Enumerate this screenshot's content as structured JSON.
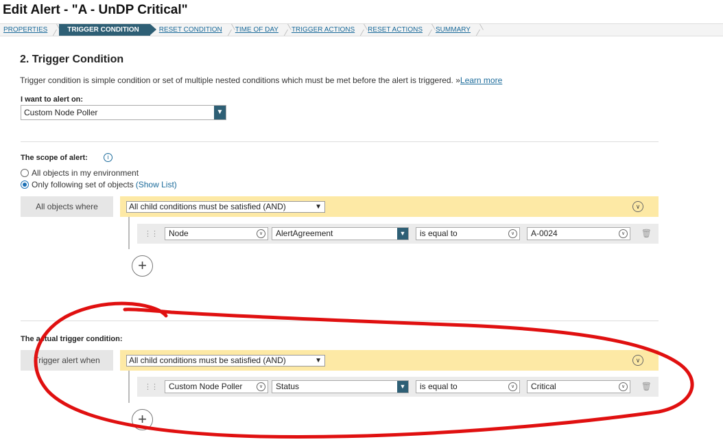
{
  "page_title": "Edit Alert - \"A - UnDP Critical\"",
  "wizard": [
    {
      "label": "PROPERTIES",
      "active": false
    },
    {
      "label": "TRIGGER CONDITION",
      "active": true
    },
    {
      "label": "RESET CONDITION",
      "active": false
    },
    {
      "label": "TIME OF DAY",
      "active": false
    },
    {
      "label": "TRIGGER ACTIONS",
      "active": false
    },
    {
      "label": "RESET ACTIONS",
      "active": false
    },
    {
      "label": "SUMMARY",
      "active": false
    }
  ],
  "section": {
    "title": "2. Trigger Condition",
    "description": "Trigger condition is simple condition or set of multiple nested conditions which must be met before the alert is triggered. »",
    "learn_more": "Learn more"
  },
  "alert_on": {
    "label": "I want to alert on:",
    "value": "Custom Node Poller"
  },
  "scope": {
    "label": "The scope of alert:",
    "options": [
      "All objects in my environment",
      "Only following set of objects"
    ],
    "selected": 1,
    "show_list": "(Show List)",
    "where_label": "All objects where",
    "group_logic": "All child conditions must be satisfied (AND)",
    "condition": {
      "entity": "Node",
      "field": "AlertAgreement",
      "operator": "is equal to",
      "value": "A-0024"
    }
  },
  "trigger": {
    "label": "The actual trigger condition:",
    "where_label": "Trigger alert when",
    "group_logic": "All child conditions must be satisfied (AND)",
    "condition": {
      "entity": "Custom Node Poller",
      "field": "Status",
      "operator": "is equal to",
      "value": "Critical"
    }
  },
  "icons": {
    "info": "info-icon",
    "collapse": "chevron-down-circle-icon",
    "grip": "drag-handle-icon",
    "delete": "trash-icon",
    "add": "plus-circle-icon"
  },
  "colors": {
    "accent": "#2e5f75",
    "link": "#1a6a9a",
    "group_bar": "#fde9a5",
    "annotation": "#e01010"
  }
}
